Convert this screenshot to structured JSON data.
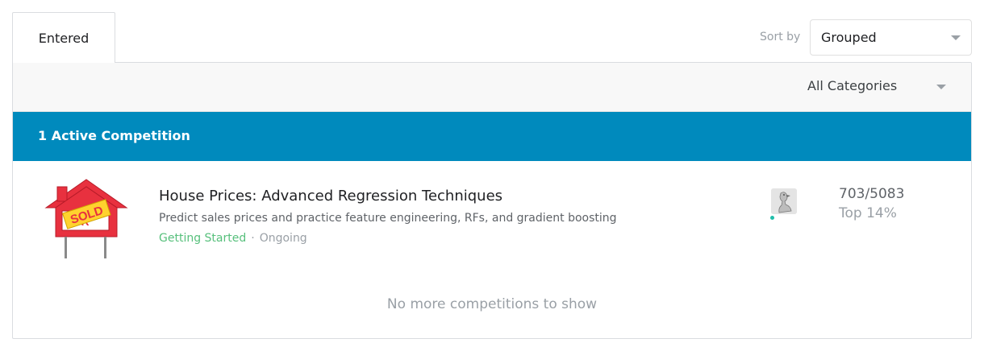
{
  "tabs": [
    {
      "label": "Entered",
      "active": true
    }
  ],
  "sort": {
    "label": "Sort by",
    "selected": "Grouped"
  },
  "filter": {
    "category_selected": "All Categories"
  },
  "group": {
    "header": "1 Active Competition"
  },
  "competitions": [
    {
      "title": "House Prices: Advanced Regression Techniques",
      "description": "Predict sales prices and practice feature engineering, RFs, and gradient boosting",
      "category": "Getting Started",
      "separator": "·",
      "status": "Ongoing",
      "thumbnail_text": "SOLD",
      "rank": "703/5083",
      "rank_percentile": "Top 14%"
    }
  ],
  "footer": {
    "message": "No more competitions to show"
  },
  "colors": {
    "group_header_bg": "#008abd",
    "category_text": "#57c07c",
    "online_dot": "#20beaa",
    "house_red": "#e8313f",
    "sign_yellow": "#ffd22e"
  },
  "icons": {
    "sort_caret": "chevron-down-icon",
    "category_caret": "chevron-down-icon",
    "thumbnail": "house-sold-sign-icon",
    "avatar": "goose-avatar-icon"
  }
}
